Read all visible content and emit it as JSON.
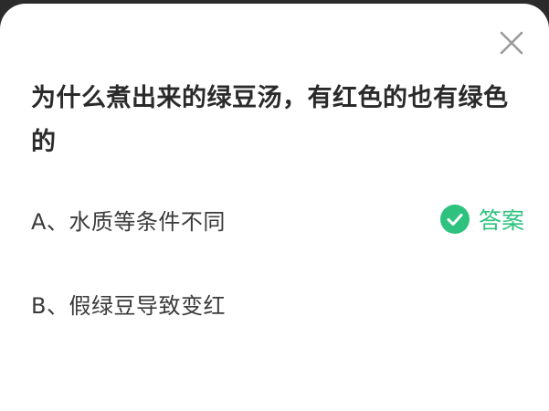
{
  "question": {
    "text": "为什么煮出来的绿豆汤，有红色的也有绿色的"
  },
  "options": [
    {
      "text": "A、水质等条件不同",
      "is_answer": true,
      "answer_label": "答案"
    },
    {
      "text": "B、假绿豆导致变红",
      "is_answer": false
    }
  ],
  "icons": {
    "close": "close-icon",
    "answer_check": "check-circle-icon"
  },
  "colors": {
    "answer_green": "#2ec27e",
    "question_text": "#2a2a2a",
    "option_text": "#3a3a3a",
    "close_icon": "#9a9a9a"
  }
}
